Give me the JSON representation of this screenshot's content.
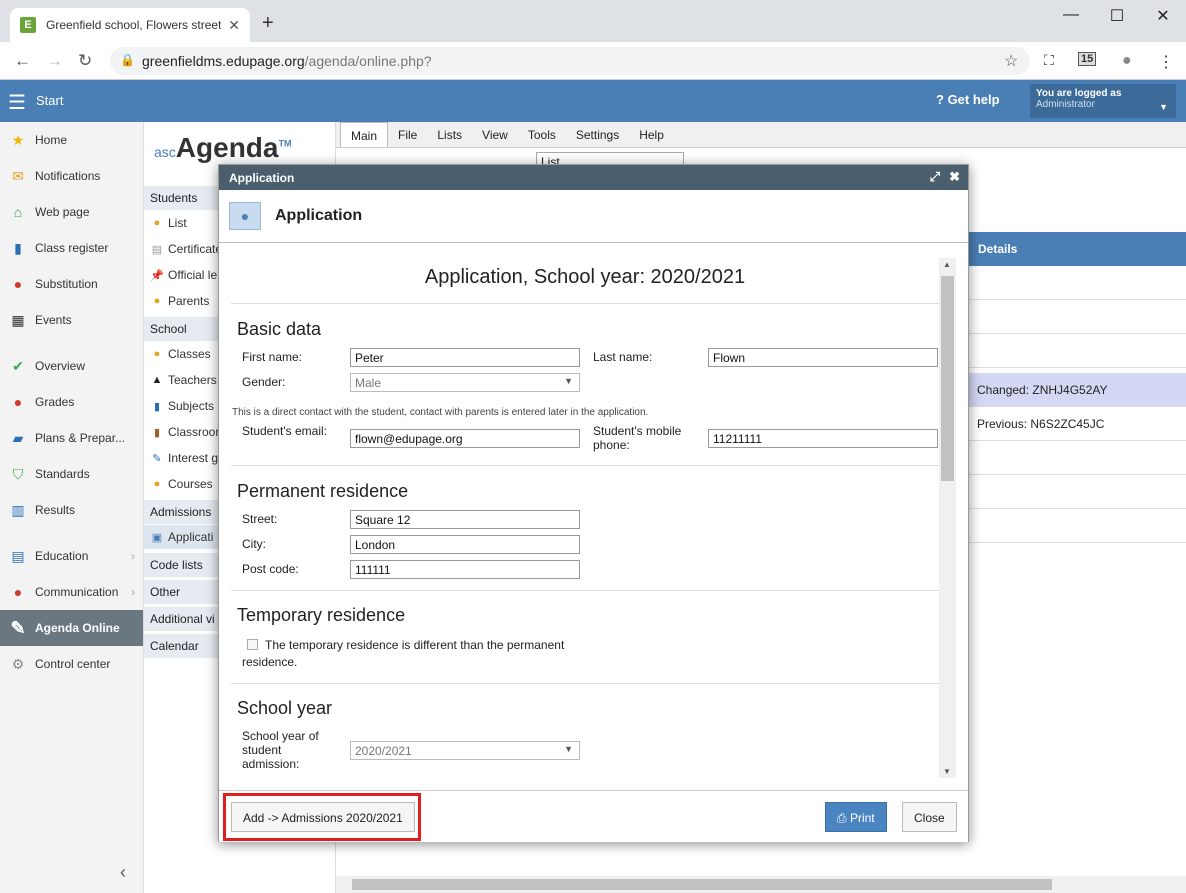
{
  "browser": {
    "tab_title": "Greenfield school, Flowers street",
    "url_host": "greenfieldms.edupage.org",
    "url_path": "/agenda/online.php?",
    "calendar_badge": "15"
  },
  "appbar": {
    "start_label": "Start",
    "help_label": "Get help",
    "logged_line1": "You are logged as",
    "logged_line2": "Administrator"
  },
  "sidebar": {
    "items": [
      {
        "label": "Home"
      },
      {
        "label": "Notifications"
      },
      {
        "label": "Web page"
      },
      {
        "label": "Class register"
      },
      {
        "label": "Substitution"
      },
      {
        "label": "Events"
      },
      {
        "label": "Overview"
      },
      {
        "label": "Grades"
      },
      {
        "label": "Plans & Prepar..."
      },
      {
        "label": "Standards"
      },
      {
        "label": "Results"
      },
      {
        "label": "Education"
      },
      {
        "label": "Communication"
      },
      {
        "label": "Agenda Online"
      },
      {
        "label": "Control center"
      }
    ]
  },
  "agenda": {
    "logo_prefix": "asc",
    "logo_name": "Agenda",
    "logo_tm": "TM",
    "students_head": "Students",
    "students_items": [
      "List",
      "Certificate",
      "Official le",
      "Parents"
    ],
    "school_head": "School",
    "school_items": [
      "Classes",
      "Teachers",
      "Subjects",
      "Classroor",
      "Interest g",
      "Courses"
    ],
    "admissions_head": "Admissions",
    "admissions_items": [
      "Applicati"
    ],
    "code_lists": "Code lists",
    "other": "Other",
    "additional": "Additional vi",
    "calendar": "Calendar"
  },
  "menubar": {
    "items": [
      "Main",
      "File",
      "Lists",
      "View",
      "Tools",
      "Settings",
      "Help"
    ]
  },
  "toolbar": {
    "select_value": "List"
  },
  "details": {
    "header": "Details",
    "rows": [
      "",
      "",
      "",
      "Changed: ZNHJ4G52AY",
      "Previous: N6S2ZC45JC",
      "",
      "",
      ""
    ]
  },
  "modal": {
    "window_title": "Application",
    "header_title": "Application",
    "form_title": "Application, School year: 2020/2021",
    "basic": {
      "title": "Basic data",
      "first_name_label": "First name:",
      "first_name": "Peter",
      "last_name_label": "Last name:",
      "last_name": "Flown",
      "gender_label": "Gender:",
      "gender": "Male",
      "note": "This is a direct contact with the student, contact with parents is entered later in the application.",
      "email_label": "Student's email:",
      "email": "flown@edupage.org",
      "mobile_label_1": "Student's mobile",
      "mobile_label_2": "phone:",
      "mobile": "11211111"
    },
    "permanent": {
      "title": "Permanent residence",
      "street_label": "Street:",
      "street": "Square 12",
      "city_label": "City:",
      "city": "London",
      "post_label": "Post code:",
      "post": "111111"
    },
    "temporary": {
      "title": "Temporary residence",
      "checkbox_line1": "The temporary residence is different than the permanent",
      "checkbox_line2": "residence."
    },
    "school_year": {
      "title": "School year",
      "label_1": "School year of",
      "label_2": "student",
      "label_3": "admission:",
      "value": "2020/2021"
    },
    "footer": {
      "add_label": "Add -> Admissions 2020/2021",
      "print_label": "Print",
      "close_label": "Close"
    }
  }
}
